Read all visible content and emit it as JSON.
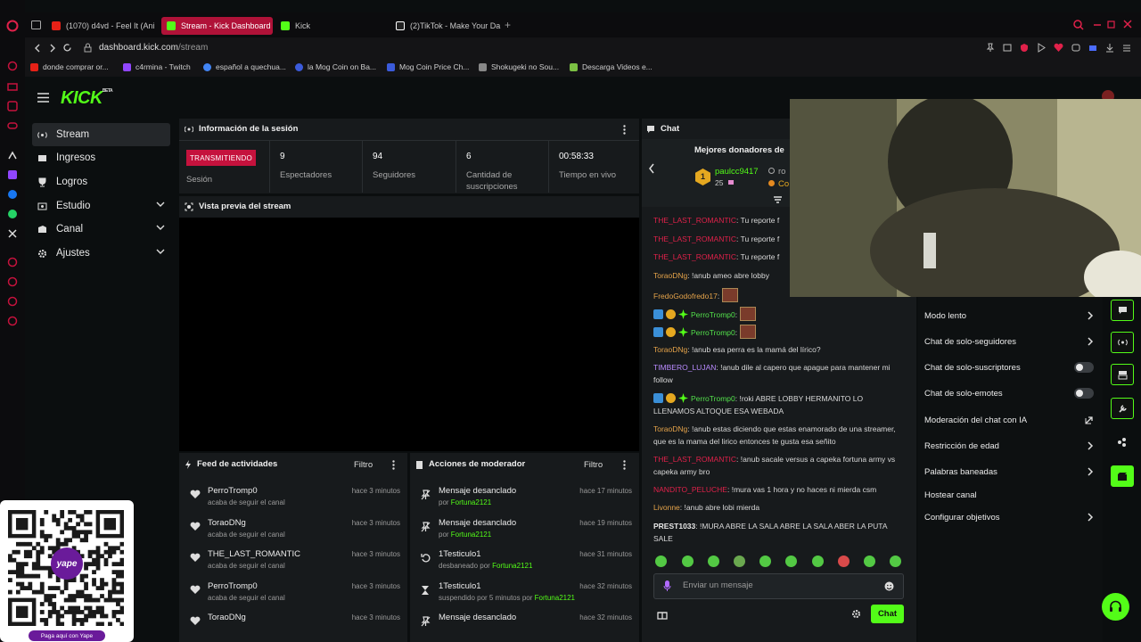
{
  "browser": {
    "tabs": [
      {
        "label": "(1070) d4vd - Feel It (Anim",
        "icon": "youtube-icon",
        "color": "#e62117"
      },
      {
        "label": "Stream - Kick Dashboard",
        "icon": "kick-icon",
        "color": "#53fc18",
        "active": true
      },
      {
        "label": "Kick",
        "icon": "kick-icon",
        "color": "#53fc18"
      },
      {
        "label": "(2)TikTok - Make Your Da",
        "icon": "tiktok-icon",
        "color": "#ffffff"
      }
    ],
    "url_host": "dashboard.kick.com",
    "url_path": "/stream",
    "bookmarks": [
      {
        "label": "donde comprar or...",
        "color": "#e62117"
      },
      {
        "label": "c4rmina - Twitch",
        "color": "#9146ff"
      },
      {
        "label": "español a quechua...",
        "color": "#4285f4"
      },
      {
        "label": "la Mog Coin on Ba...",
        "color": "#3b5bdb"
      },
      {
        "label": "Mog Coin Price Ch...",
        "color": "#3b5bdb"
      },
      {
        "label": "Shokugeki no Sou...",
        "color": "#888888"
      },
      {
        "label": "Descarga Videos e...",
        "color": "#7bc043"
      }
    ]
  },
  "brand": {
    "logo": "KICK",
    "logo_tag": "BETA",
    "accent": "#53fc18"
  },
  "sidebar": {
    "items": [
      {
        "label": "Stream",
        "icon": "stream-icon",
        "active": true
      },
      {
        "label": "Ingresos",
        "icon": "wallet-icon"
      },
      {
        "label": "Logros",
        "icon": "trophy-icon"
      },
      {
        "label": "Estudio",
        "icon": "studio-icon",
        "expand": true
      },
      {
        "label": "Canal",
        "icon": "channel-icon",
        "expand": true
      },
      {
        "label": "Ajustes",
        "icon": "gear-icon",
        "expand": true
      }
    ]
  },
  "session": {
    "title": "Información de la sesión",
    "status": "TRANSMITIENDO",
    "status_label": "Sesión",
    "stats": [
      {
        "value": "9",
        "label": "Espectadores"
      },
      {
        "value": "94",
        "label": "Seguidores"
      },
      {
        "value": "6",
        "label": "Cantidad de suscripciones"
      },
      {
        "value": "00:58:33",
        "label": "Tiempo en vivo"
      }
    ]
  },
  "preview": {
    "title": "Vista previa del stream"
  },
  "feed": {
    "title": "Feed de actividades",
    "filter": "Filtro",
    "rows": [
      {
        "name": "PerroTromp0",
        "sub": "acaba de seguir el canal",
        "time": "hace 3 minutos"
      },
      {
        "name": "ToraoDNg",
        "sub": "acaba de seguir el canal",
        "time": "hace 3 minutos"
      },
      {
        "name": "THE_LAST_ROMANTIC",
        "sub": "acaba de seguir el canal",
        "time": "hace 3 minutos"
      },
      {
        "name": "PerroTromp0",
        "sub": "acaba de seguir el canal",
        "time": "hace 3 minutos"
      },
      {
        "name": "ToraoDNg",
        "sub": "",
        "time": "hace 3 minutos"
      }
    ]
  },
  "mod": {
    "title": "Acciones de moderador",
    "filter": "Filtro",
    "rows": [
      {
        "name": "Mensaje desanclado",
        "sub_pre": "por ",
        "sub_user": "Fortuna2121",
        "time": "hace 17 minutos",
        "icon": "unpin-icon"
      },
      {
        "name": "Mensaje desanclado",
        "sub_pre": "por ",
        "sub_user": "Fortuna2121",
        "time": "hace 19 minutos",
        "icon": "unpin-icon"
      },
      {
        "name": "1Testiculo1",
        "sub_pre": "desbaneado por ",
        "sub_user": "Fortuna2121",
        "time": "hace 31 minutos",
        "icon": "undo-icon"
      },
      {
        "name": "1Testiculo1",
        "sub_pre": "suspendido por 5 minutos por ",
        "sub_user": "Fortuna2121",
        "time": "hace 32 minutos",
        "icon": "hourglass-icon"
      },
      {
        "name": "Mensaje desanclado",
        "sub_pre": "",
        "sub_user": "",
        "time": "hace 32 minutos",
        "icon": "unpin-icon"
      }
    ]
  },
  "chat": {
    "title": "Chat",
    "top_donors": "Mejores donadores de",
    "donor_name": "paulcc9417",
    "donor_amount": "25",
    "donor_other": "ro",
    "donor_other2": "Co",
    "messages": [
      {
        "user": "THE_LAST_ROMANTIC",
        "cls": "u-red",
        "text": ": Tu reporte f"
      },
      {
        "user": "THE_LAST_ROMANTIC",
        "cls": "u-red",
        "text": ": Tu reporte f"
      },
      {
        "user": "THE_LAST_ROMANTIC",
        "cls": "u-red",
        "text": ": Tu reporte f"
      },
      {
        "user": "ToraoDNg",
        "cls": "u-orange",
        "text": ": !anub ameo abre lobby"
      },
      {
        "user": "FredoGodofredo17",
        "cls": "u-orange",
        "text": ":"
      },
      {
        "user": "PerroTromp0",
        "cls": "u-green",
        "text": ":"
      },
      {
        "user": "PerroTromp0",
        "cls": "u-green",
        "text": ":"
      },
      {
        "user": "ToraoDNg",
        "cls": "u-orange",
        "text": ": !anub esa perra es la mamá del lírico?"
      },
      {
        "user": "TIMBERO_LUJAN",
        "cls": "u-purple",
        "text": ": !anub dile al capero que apague para mantener mi follow"
      },
      {
        "user": "PerroTromp0",
        "cls": "u-green",
        "text": ": !roki ABRE LOBBY HERMANITO LO LLENAMOS ALTOQUE ESA WEBADA"
      },
      {
        "user": "ToraoDNg",
        "cls": "u-orange",
        "text": ": !anub estas diciendo que estas enamorado de una streamer, que es la mama del lirico entonces te gusta esa señito"
      },
      {
        "user": "THE_LAST_ROMANTIC",
        "cls": "u-red",
        "text": ": !anub sacale versus a capeka fortuna army vs capeka army bro"
      },
      {
        "user": "NANDITO_PELUCHE",
        "cls": "u-red",
        "text": ": !mura vas 1 hora y no haces ni mierda csm"
      },
      {
        "user": "Livonne",
        "cls": "u-orange",
        "text": ": !anub abre lobi mierda"
      },
      {
        "user": "PREST1033",
        "cls": "u-white",
        "text": ": !MURA ABRE LA SALA ABRE LA SALA ABER LA PUTA SALE"
      }
    ],
    "input_placeholder": "Enviar un mensaje",
    "send_label": "Chat"
  },
  "chat_settings": {
    "items": [
      {
        "label": "Modo lento",
        "control": "chevron"
      },
      {
        "label": "Chat de solo-seguidores",
        "control": "chevron"
      },
      {
        "label": "Chat de solo-suscriptores",
        "control": "toggle"
      },
      {
        "label": "Chat de solo-emotes",
        "control": "toggle"
      },
      {
        "label": "Moderación del chat con IA",
        "control": "external"
      },
      {
        "label": "Restricción de edad",
        "control": "chevron"
      },
      {
        "label": "Palabras baneadas",
        "control": "chevron"
      },
      {
        "label": "Hostear canal",
        "control": "none"
      },
      {
        "label": "Configurar objetivos",
        "control": "chevron"
      }
    ]
  },
  "qr": {
    "brand": "yape",
    "caption": "Paga aquí con Yape"
  }
}
